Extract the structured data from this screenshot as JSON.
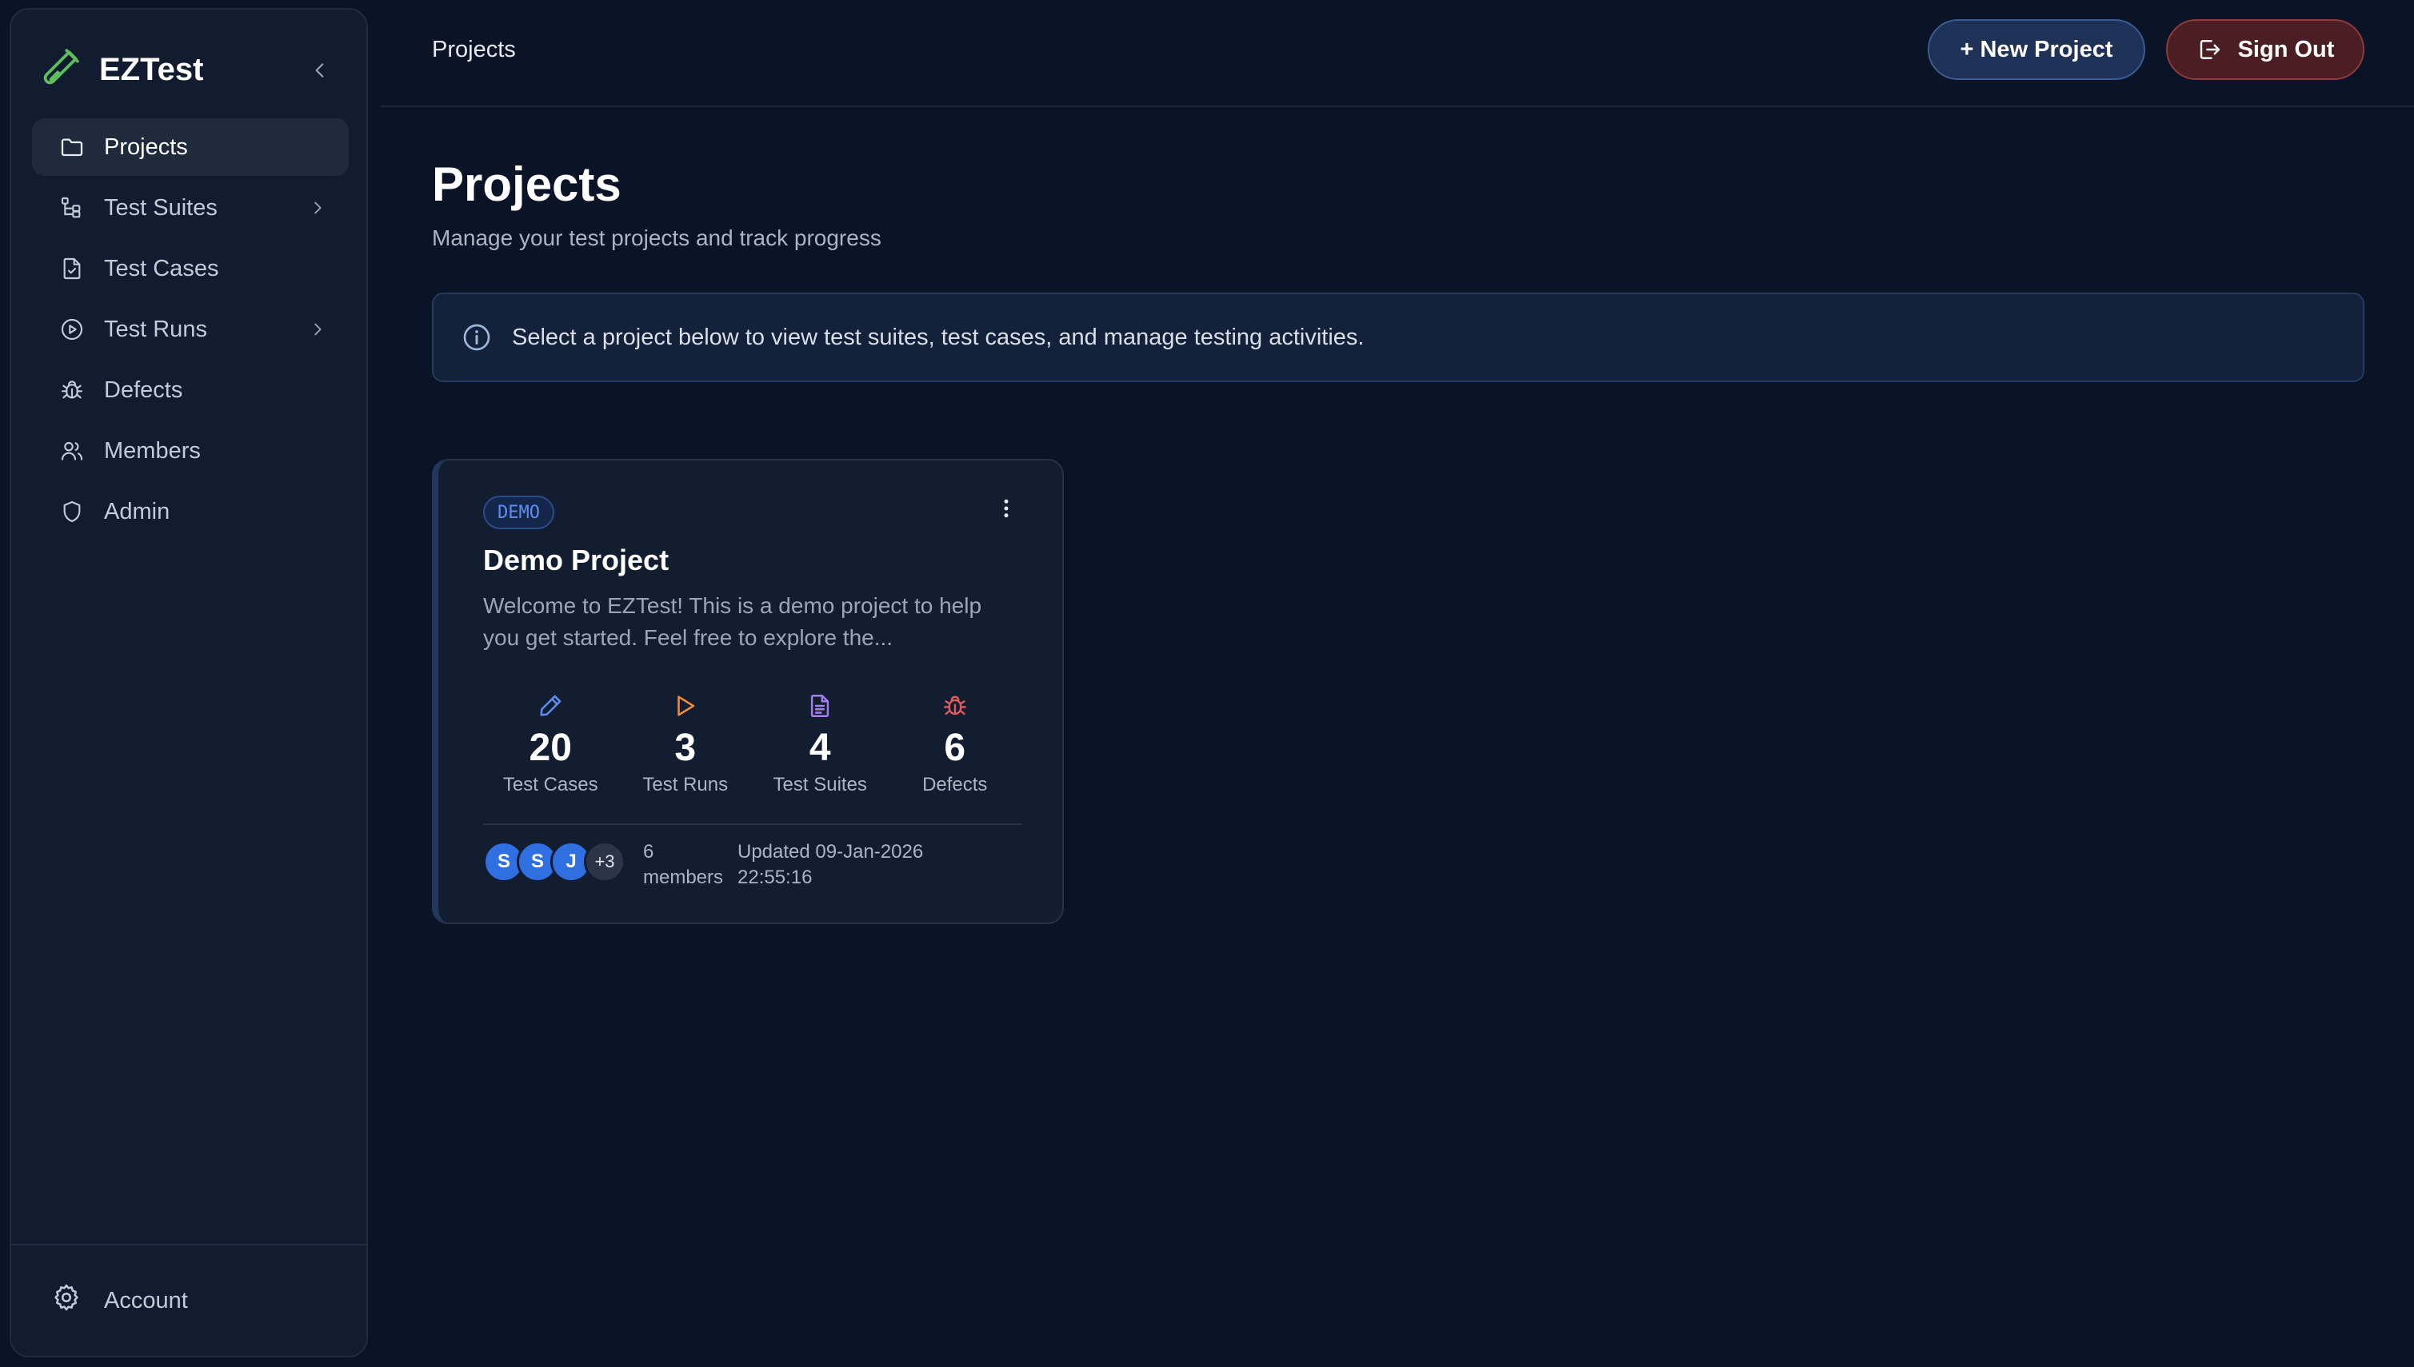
{
  "app": {
    "name": "EZTest"
  },
  "sidebar": {
    "items": [
      {
        "label": "Projects",
        "icon": "folder-icon",
        "active": true
      },
      {
        "label": "Test Suites",
        "icon": "tree-icon",
        "has_submenu": true
      },
      {
        "label": "Test Cases",
        "icon": "file-check-icon"
      },
      {
        "label": "Test Runs",
        "icon": "play-circle-icon",
        "has_submenu": true
      },
      {
        "label": "Defects",
        "icon": "bug-icon"
      },
      {
        "label": "Members",
        "icon": "users-icon"
      },
      {
        "label": "Admin",
        "icon": "shield-icon"
      }
    ],
    "footer": {
      "account_label": "Account",
      "icon": "gear-icon"
    }
  },
  "header": {
    "breadcrumb": "Projects",
    "new_project_label": "+ New Project",
    "sign_out_label": "Sign Out"
  },
  "main": {
    "title": "Projects",
    "subtitle": "Manage your test projects and track progress",
    "info_banner": "Select a project below to view test suites, test cases, and manage testing activities."
  },
  "projects": [
    {
      "badge": "DEMO",
      "name": "Demo Project",
      "description": "Welcome to EZTest! This is a demo project to help you get started. Feel free to explore the...",
      "stats": [
        {
          "value": "20",
          "label": "Test Cases",
          "icon": "pencil-icon",
          "color": "#5b8def"
        },
        {
          "value": "3",
          "label": "Test Runs",
          "icon": "play-icon",
          "color": "#f08a3c"
        },
        {
          "value": "4",
          "label": "Test Suites",
          "icon": "document-icon",
          "color": "#a77ef0"
        },
        {
          "value": "6",
          "label": "Defects",
          "icon": "bug-icon",
          "color": "#e05a5a"
        }
      ],
      "avatars": [
        "S",
        "S",
        "J",
        "+3"
      ],
      "members_text": "6 members",
      "updated_text": "Updated 09-Jan-2026 22:55:16"
    }
  ],
  "colors": {
    "background": "#0b1426",
    "sidebar": "#111c30",
    "accent_blue": "#2f6fe0",
    "danger": "#8e3a3d",
    "logo_green": "#4caf50"
  }
}
